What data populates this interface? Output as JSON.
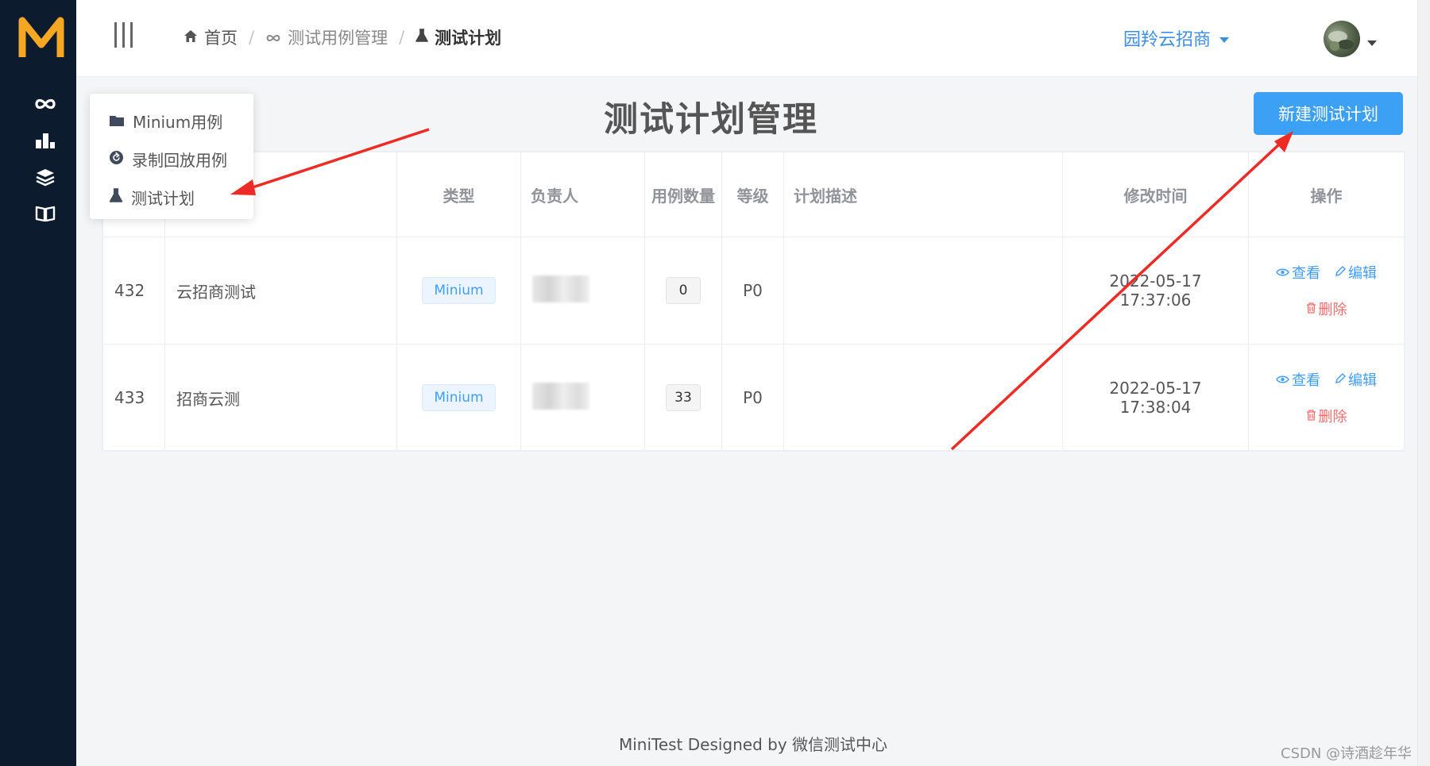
{
  "app": {
    "logo_letter": "M"
  },
  "sidebar": {
    "items": [
      {
        "icon": "infinity-icon"
      },
      {
        "icon": "bar-chart-icon"
      },
      {
        "icon": "layers-icon"
      },
      {
        "icon": "book-icon"
      }
    ]
  },
  "header": {
    "breadcrumb": [
      {
        "label": "首页",
        "icon": "home-icon"
      },
      {
        "label": "测试用例管理",
        "icon": "infinity-icon"
      },
      {
        "label": "测试计划",
        "icon": "flask-icon"
      }
    ],
    "separator": "/",
    "user_name": "园羚云招商"
  },
  "page": {
    "title": "测试计划管理",
    "new_button": "新建测试计划"
  },
  "dropdown_menu": {
    "items": [
      {
        "label": "Minium用例",
        "icon": "folder-icon"
      },
      {
        "label": "录制回放用例",
        "icon": "replay-icon"
      },
      {
        "label": "测试计划",
        "icon": "flask-icon"
      }
    ]
  },
  "table": {
    "headers": [
      "类型",
      "负责人",
      "用例数量",
      "等级",
      "计划描述",
      "修改时间",
      "操作"
    ],
    "rows": [
      {
        "id": "432",
        "name": "云招商测试",
        "type": "Minium",
        "count": "0",
        "level": "P0",
        "desc": "",
        "modified": "2022-05-17 17:37:06"
      },
      {
        "id": "433",
        "name": "招商云测",
        "type": "Minium",
        "count": "33",
        "level": "P0",
        "desc": "",
        "modified": "2022-05-17 17:38:04"
      }
    ],
    "actions": {
      "view": "查看",
      "edit": "编辑",
      "delete": "删除"
    }
  },
  "footer": {
    "text": "MiniTest Designed by 微信测试中心"
  },
  "watermark": "CSDN @诗酒趁年华",
  "colors": {
    "sidebar_bg": "#0d1b2e",
    "logo": "#f5a623",
    "primary": "#3ca0f5",
    "link": "#409eff",
    "danger": "#f56c6c",
    "annotation": "#ee2a24"
  }
}
